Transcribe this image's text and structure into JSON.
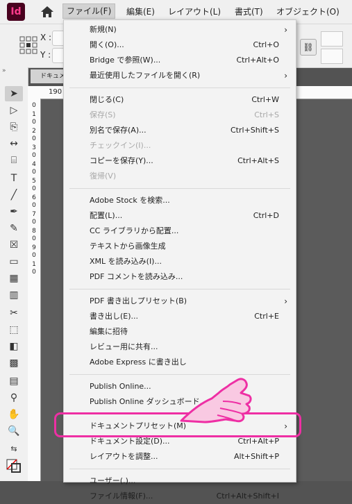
{
  "app": {
    "logo_text": "Id"
  },
  "menubar": {
    "items": [
      "ファイル(F)",
      "編集(E)",
      "レイアウト(L)",
      "書式(T)",
      "オブジェクト(O)"
    ]
  },
  "controlbar": {
    "x_label": "X :",
    "y_label": "Y :"
  },
  "document_tab": {
    "label": "ドキュメント"
  },
  "ruler": {
    "top_value": "190",
    "left_digits": [
      "0",
      "1",
      "0",
      "2",
      "0",
      "3",
      "0",
      "4",
      "0",
      "5",
      "0",
      "6",
      "0",
      "7",
      "0",
      "8",
      "0",
      "9",
      "0",
      "1",
      "0"
    ]
  },
  "file_menu": {
    "groups": [
      [
        {
          "label": "新規(N)",
          "shortcut": "",
          "submenu": true,
          "disabled": false
        },
        {
          "label": "開く(O)...",
          "shortcut": "Ctrl+O",
          "submenu": false,
          "disabled": false
        },
        {
          "label": "Bridge で参照(W)...",
          "shortcut": "Ctrl+Alt+O",
          "submenu": false,
          "disabled": false
        },
        {
          "label": "最近使用したファイルを開く(R)",
          "shortcut": "",
          "submenu": true,
          "disabled": false
        }
      ],
      [
        {
          "label": "閉じる(C)",
          "shortcut": "Ctrl+W",
          "submenu": false,
          "disabled": false
        },
        {
          "label": "保存(S)",
          "shortcut": "Ctrl+S",
          "submenu": false,
          "disabled": true
        },
        {
          "label": "別名で保存(A)...",
          "shortcut": "Ctrl+Shift+S",
          "submenu": false,
          "disabled": false
        },
        {
          "label": "チェックイン(I)...",
          "shortcut": "",
          "submenu": false,
          "disabled": true
        },
        {
          "label": "コピーを保存(Y)...",
          "shortcut": "Ctrl+Alt+S",
          "submenu": false,
          "disabled": false
        },
        {
          "label": "復帰(V)",
          "shortcut": "",
          "submenu": false,
          "disabled": true
        }
      ],
      [
        {
          "label": "Adobe Stock を検索...",
          "shortcut": "",
          "submenu": false,
          "disabled": false
        },
        {
          "label": "配置(L)...",
          "shortcut": "Ctrl+D",
          "submenu": false,
          "disabled": false
        },
        {
          "label": "CC ライブラリから配置...",
          "shortcut": "",
          "submenu": false,
          "disabled": false
        },
        {
          "label": "テキストから画像生成",
          "shortcut": "",
          "submenu": false,
          "disabled": false
        },
        {
          "label": "XML を読み込み(I)...",
          "shortcut": "",
          "submenu": false,
          "disabled": false
        },
        {
          "label": "PDF コメントを読み込み...",
          "shortcut": "",
          "submenu": false,
          "disabled": false
        }
      ],
      [
        {
          "label": "PDF 書き出しプリセット(B)",
          "shortcut": "",
          "submenu": true,
          "disabled": false
        },
        {
          "label": "書き出し(E)...",
          "shortcut": "Ctrl+E",
          "submenu": false,
          "disabled": false
        },
        {
          "label": "編集に招待",
          "shortcut": "",
          "submenu": false,
          "disabled": false
        },
        {
          "label": "レビュー用に共有...",
          "shortcut": "",
          "submenu": false,
          "disabled": false
        },
        {
          "label": "Adobe Express に書き出し",
          "shortcut": "",
          "submenu": false,
          "disabled": false
        }
      ],
      [
        {
          "label": "Publish Online...",
          "shortcut": "",
          "submenu": false,
          "disabled": false
        },
        {
          "label": "Publish Online ダッシュボード...",
          "shortcut": "",
          "submenu": false,
          "disabled": false
        }
      ],
      [
        {
          "label": "ドキュメントプリセット(M)",
          "shortcut": "",
          "submenu": true,
          "disabled": false
        },
        {
          "label": "ドキュメント設定(D)...",
          "shortcut": "Ctrl+Alt+P",
          "submenu": false,
          "disabled": false
        },
        {
          "label": "レイアウトを調整...",
          "shortcut": "Alt+Shift+P",
          "submenu": false,
          "disabled": false
        }
      ],
      [
        {
          "label": "ユーザー(.)...",
          "shortcut": "",
          "submenu": false,
          "disabled": false
        },
        {
          "label": "ファイル情報(F)...",
          "shortcut": "Ctrl+Alt+Shift+I",
          "submenu": false,
          "disabled": false
        }
      ]
    ]
  },
  "highlight": {
    "color": "#ee2fa4"
  },
  "colors": {
    "accent_pink": "#ee2fa4",
    "logo_bg": "#49021f",
    "logo_text": "#ff3b8b"
  }
}
